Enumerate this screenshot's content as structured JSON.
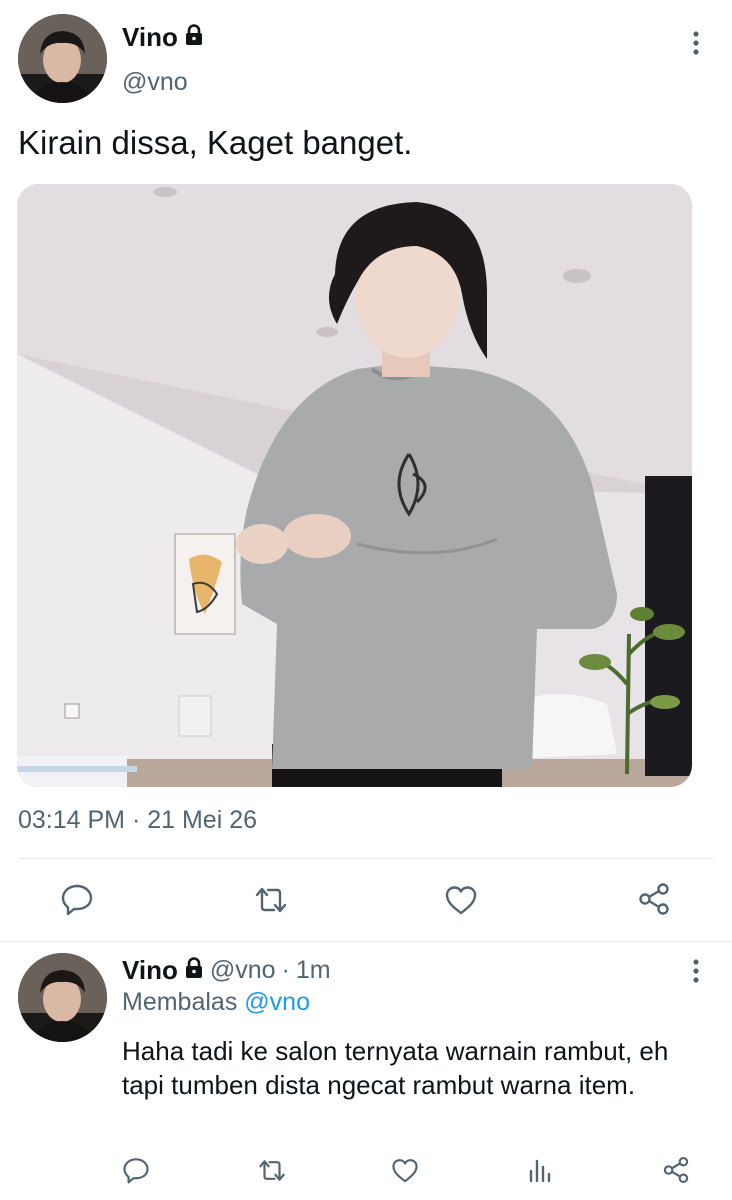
{
  "main_tweet": {
    "author_name": "Vino",
    "author_handle": "@vno",
    "text": "Kirain dissa, Kaget banget.",
    "timestamp": "03:14 PM · 21 Mei 26",
    "actions": [
      "reply-icon",
      "retweet-icon",
      "like-icon",
      "share-icon"
    ],
    "icons": {
      "locked": "lock-icon",
      "menu": "more-vertical-icon"
    }
  },
  "reply": {
    "author_name": "Vino",
    "author_handle": "@vno",
    "separator": "·",
    "time_ago": "1m",
    "replying_prefix": "Membalas",
    "replying_to": "@vno",
    "text": "Haha tadi ke salon ternyata warnain rambut, eh tapi tumben dista ngecat rambut warna item.",
    "actions": [
      "reply-icon",
      "retweet-icon",
      "like-icon",
      "analytics-icon",
      "share-icon"
    ]
  },
  "colors": {
    "text_primary": "#0f1419",
    "text_secondary": "#536471",
    "link": "#1d9bf0",
    "divider": "#e4e8eb"
  }
}
